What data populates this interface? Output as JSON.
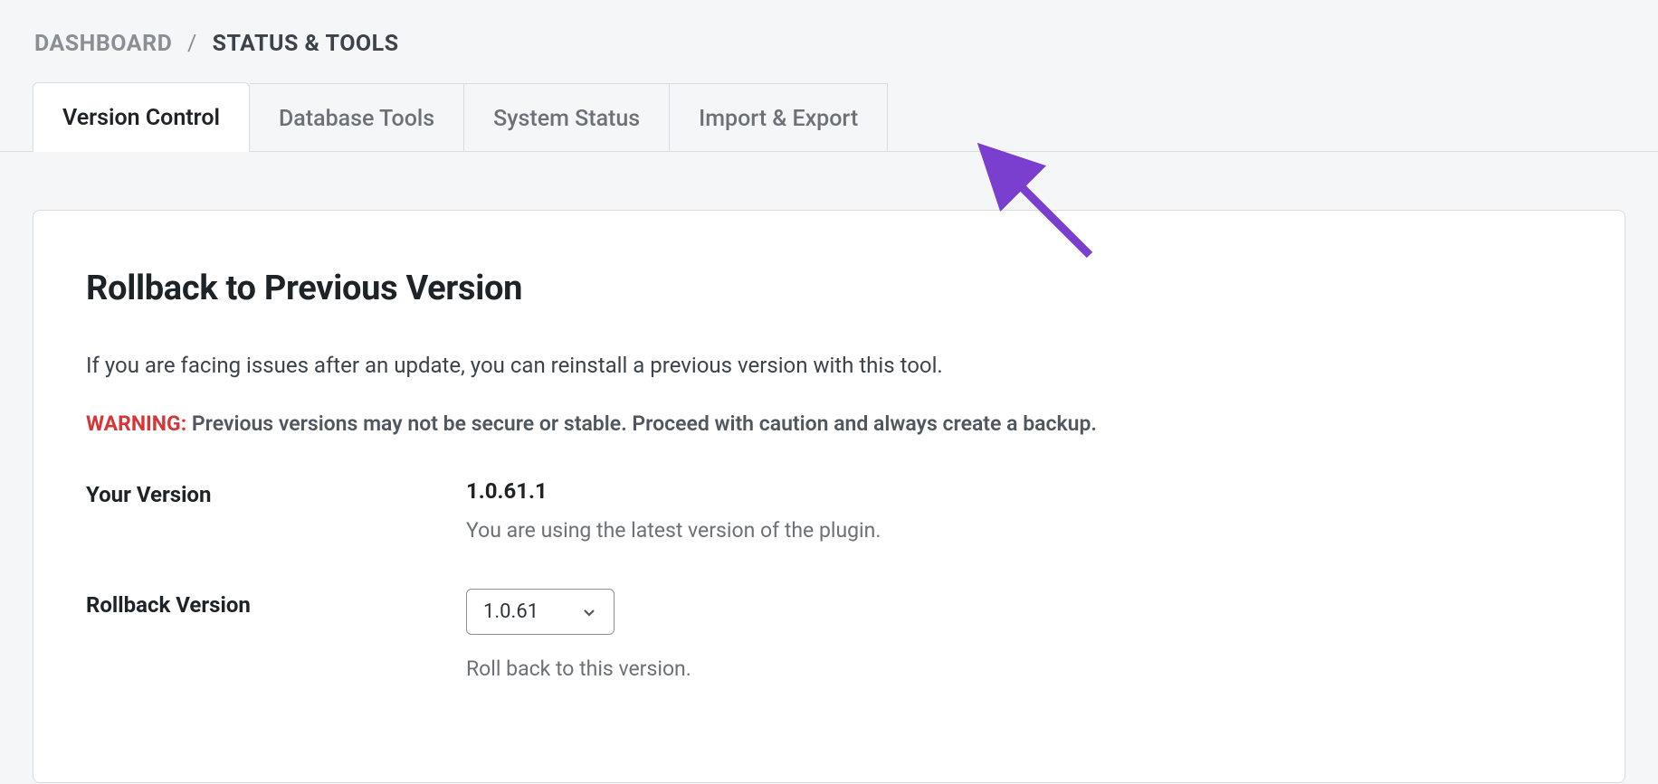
{
  "breadcrumb": {
    "root": "DASHBOARD",
    "separator": "/",
    "current": "STATUS & TOOLS"
  },
  "tabs": [
    {
      "label": "Version Control",
      "active": true
    },
    {
      "label": "Database Tools",
      "active": false
    },
    {
      "label": "System Status",
      "active": false
    },
    {
      "label": "Import & Export",
      "active": false
    }
  ],
  "panel": {
    "heading": "Rollback to Previous Version",
    "intro": "If you are facing issues after an update, you can reinstall a previous version with this tool.",
    "warning_label": "WARNING:",
    "warning_text": "Previous versions may not be secure or stable. Proceed with caution and always create a backup.",
    "your_version_label": "Your Version",
    "your_version_value": "1.0.61.1",
    "your_version_desc": "You are using the latest version of the plugin.",
    "rollback_label": "Rollback Version",
    "rollback_selected": "1.0.61",
    "rollback_desc": "Roll back to this version."
  },
  "colors": {
    "warning": "#d63638",
    "cursor_arrow": "#7b3fcf"
  }
}
